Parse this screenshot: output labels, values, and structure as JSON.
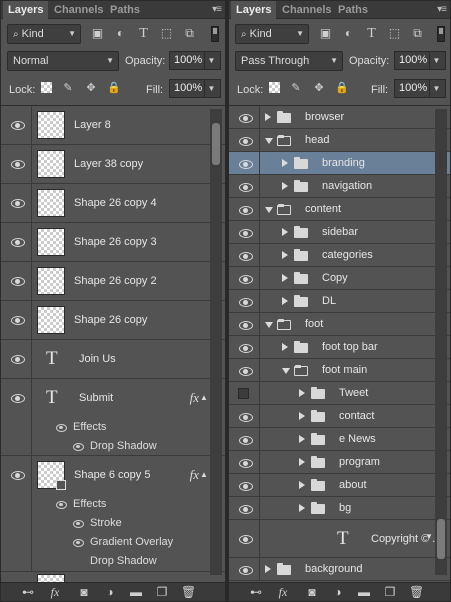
{
  "left_panel": {
    "tabs": [
      "Layers",
      "Channels",
      "Paths"
    ],
    "filter": {
      "label": "Kind"
    },
    "blend_mode": "Normal",
    "opacity_label": "Opacity:",
    "opacity_value": "100%",
    "lock_label": "Lock:",
    "fill_label": "Fill:",
    "fill_value": "100%",
    "layers": [
      {
        "name": "Layer 8",
        "type": "raster"
      },
      {
        "name": "Layer 38 copy",
        "type": "raster"
      },
      {
        "name": "Shape 26 copy 4",
        "type": "raster"
      },
      {
        "name": "Shape 26 copy 3",
        "type": "raster"
      },
      {
        "name": "Shape 26 copy 2",
        "type": "raster"
      },
      {
        "name": "Shape 26 copy",
        "type": "raster"
      },
      {
        "name": "Join Us",
        "type": "text"
      },
      {
        "name": "Submit",
        "type": "text",
        "fx": "fx",
        "effects_label": "Effects",
        "effects": [
          "Drop Shadow"
        ]
      },
      {
        "name": "Shape 6 copy 5",
        "type": "shape",
        "fx": "fx",
        "effects_label": "Effects",
        "effects": [
          "Stroke",
          "Gradient Overlay",
          "Drop Shadow"
        ]
      }
    ],
    "scroll_fraction": 0.0
  },
  "right_panel": {
    "tabs": [
      "Layers",
      "Channels",
      "Paths"
    ],
    "filter": {
      "label": "Kind"
    },
    "blend_mode": "Pass Through",
    "opacity_label": "Opacity:",
    "opacity_value": "100%",
    "lock_label": "Lock:",
    "fill_label": "Fill:",
    "fill_value": "100%",
    "layers": [
      {
        "name": "browser",
        "depth": 0,
        "open": false,
        "visible": true
      },
      {
        "name": "head",
        "depth": 0,
        "open": true,
        "visible": true
      },
      {
        "name": "branding",
        "depth": 1,
        "open": false,
        "visible": true,
        "selected": true
      },
      {
        "name": "navigation",
        "depth": 1,
        "open": false,
        "visible": true
      },
      {
        "name": "content",
        "depth": 0,
        "open": true,
        "visible": true
      },
      {
        "name": "sidebar",
        "depth": 1,
        "open": false,
        "visible": true
      },
      {
        "name": "categories",
        "depth": 1,
        "open": false,
        "visible": true
      },
      {
        "name": "Copy",
        "depth": 1,
        "open": false,
        "visible": true
      },
      {
        "name": "DL",
        "depth": 1,
        "open": false,
        "visible": true
      },
      {
        "name": "foot",
        "depth": 0,
        "open": true,
        "visible": true
      },
      {
        "name": "foot top bar",
        "depth": 1,
        "open": false,
        "visible": true
      },
      {
        "name": "foot main",
        "depth": 1,
        "open": true,
        "visible": true
      },
      {
        "name": "Tweet",
        "depth": 2,
        "open": false,
        "visible": false
      },
      {
        "name": "contact",
        "depth": 2,
        "open": false,
        "visible": true
      },
      {
        "name": "e News",
        "depth": 2,
        "open": false,
        "visible": true
      },
      {
        "name": "program",
        "depth": 2,
        "open": false,
        "visible": true
      },
      {
        "name": "about",
        "depth": 2,
        "open": false,
        "visible": true
      },
      {
        "name": "bg",
        "depth": 2,
        "open": false,
        "visible": true
      },
      {
        "name": "Copyright © ...",
        "depth": 2,
        "type": "text",
        "visible": true
      },
      {
        "name": "background",
        "depth": 0,
        "open": false,
        "visible": true
      }
    ]
  },
  "colors": {
    "panel_bg": "#535353",
    "selected_row": "#6a7f98",
    "tab_bar": "#3a3a3a"
  }
}
